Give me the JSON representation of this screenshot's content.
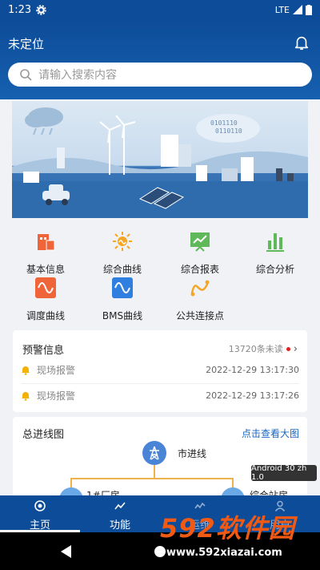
{
  "status_bar": {
    "time": "1:23",
    "network": "LTE"
  },
  "header": {
    "location": "未定位"
  },
  "search": {
    "placeholder": "请输入搜索内容"
  },
  "banner": {
    "digits_line1": "0101110",
    "digits_line2": "0110110"
  },
  "functions": [
    {
      "label": "基本信息",
      "icon": "building-info-icon",
      "color": "#f0643a"
    },
    {
      "label": "综合曲线",
      "icon": "sun-curve-icon",
      "color": "#f5a623"
    },
    {
      "label": "综合报表",
      "icon": "report-chart-icon",
      "color": "#5fb85a"
    },
    {
      "label": "综合分析",
      "icon": "bar-chart-icon",
      "color": "#5fb85a"
    },
    {
      "label": "调度曲线",
      "icon": "wave-icon",
      "color": "#f0643a"
    },
    {
      "label": "BMS曲线",
      "icon": "bms-wave-icon",
      "color": "#2f7fe0"
    },
    {
      "label": "公共连接点",
      "icon": "connection-point-icon",
      "color": "#f5a623"
    }
  ],
  "alerts": {
    "title": "预警信息",
    "unread": "13720条未读",
    "items": [
      {
        "text": "现场报警",
        "time": "2022-12-29 13:17:30"
      },
      {
        "text": "现场报警",
        "time": "2022-12-29 13:17:26"
      }
    ]
  },
  "diagram": {
    "title": "总进线图",
    "link": "点击查看大图",
    "root": "市进线",
    "left": "1#厂房",
    "right": "综合站房"
  },
  "version_tag": "Android 30 zh 1.0",
  "tabs": [
    {
      "label": "主页",
      "icon": "home-aperture-icon",
      "active": true
    },
    {
      "label": "功能",
      "icon": "chart-line-icon",
      "active": false
    },
    {
      "label": "运维",
      "icon": "wave-line-icon",
      "active": false
    },
    {
      "label": "用户",
      "icon": "user-icon",
      "active": false
    }
  ],
  "watermark": {
    "brand": "592软件园",
    "url": "www.592xiazai.com"
  },
  "colors": {
    "primary": "#0d4c98",
    "accent": "#f0b24a",
    "link": "#1a66c2",
    "alert_dot": "#e02020"
  }
}
